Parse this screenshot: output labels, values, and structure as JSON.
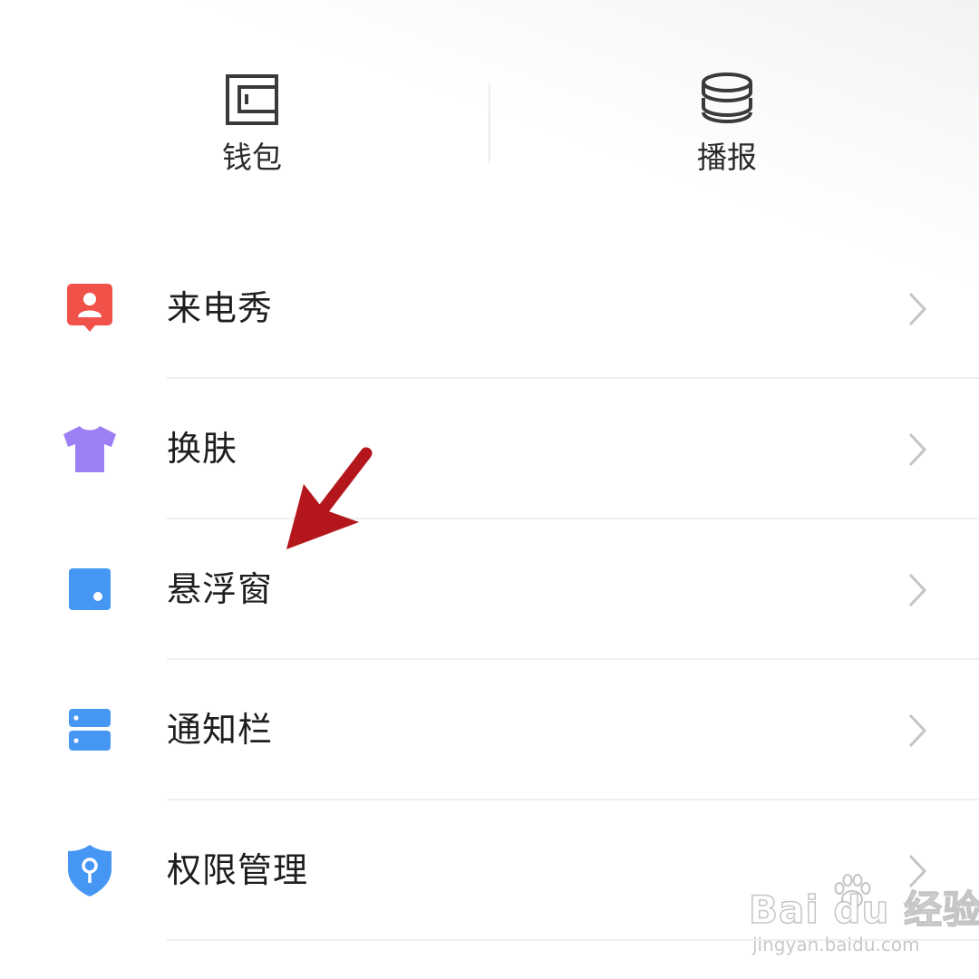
{
  "shortcuts": {
    "wallet": {
      "label": "钱包",
      "icon": "wallet-icon"
    },
    "broadcast": {
      "label": "播报",
      "icon": "database-stack-icon"
    }
  },
  "menu": {
    "items": [
      {
        "label": "来电秀",
        "icon": "caller-show-icon",
        "icon_color": "#f0524a"
      },
      {
        "label": "换肤",
        "icon": "tshirt-icon",
        "icon_color": "#9d7ff5"
      },
      {
        "label": "悬浮窗",
        "icon": "floating-window-icon",
        "icon_color": "#4696f4"
      },
      {
        "label": "通知栏",
        "icon": "notification-bar-icon",
        "icon_color": "#4696f4"
      },
      {
        "label": "权限管理",
        "icon": "shield-key-icon",
        "icon_color": "#4696f4"
      }
    ]
  },
  "annotation": {
    "color": "#b3171c"
  },
  "watermark": {
    "brand": "Bai du 经验",
    "sub": "jingyan.baidu.com"
  }
}
